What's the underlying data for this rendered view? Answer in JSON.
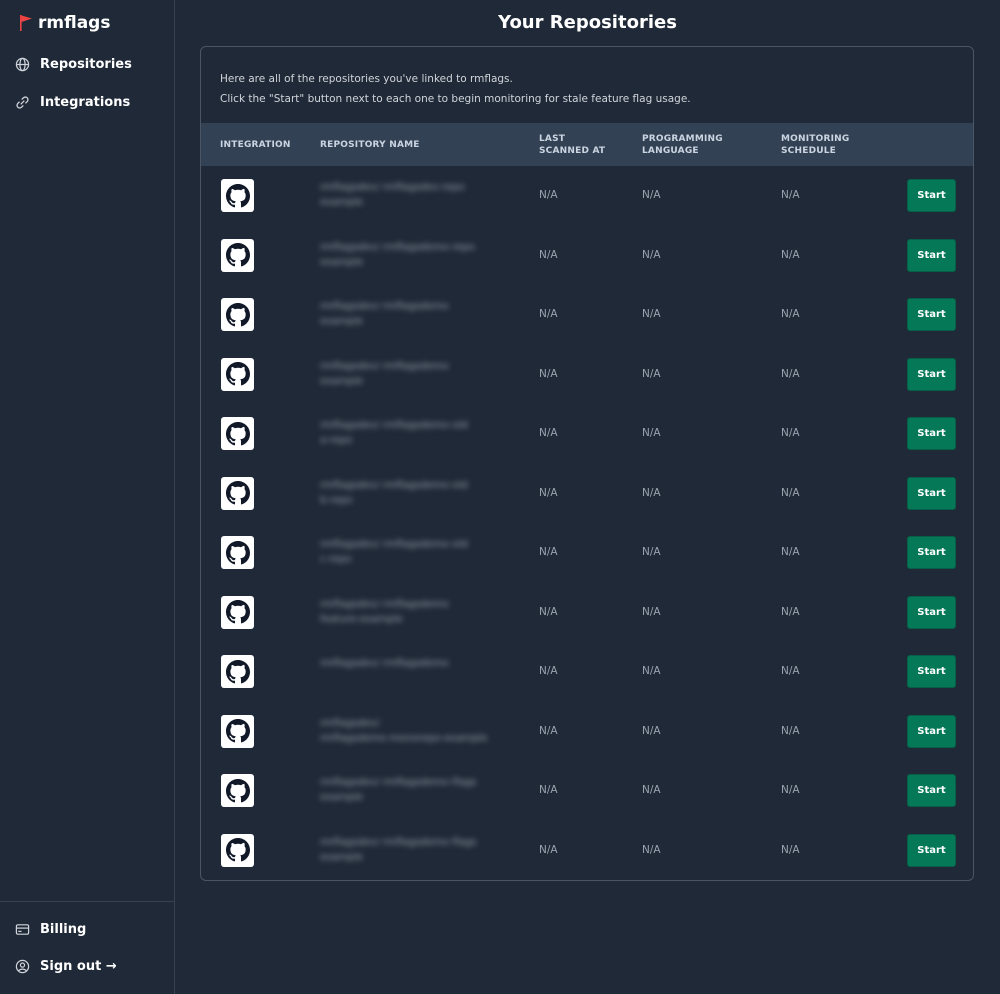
{
  "app": {
    "name": "rmflags",
    "flag_color": "#ef4444"
  },
  "nav": {
    "repositories": "Repositories",
    "integrations": "Integrations",
    "billing": "Billing",
    "signout": "Sign out →"
  },
  "page": {
    "title": "Your Repositories",
    "intro_line1": "Here are all of the repositories you've linked to rmflags.",
    "intro_line2": "Click the \"Start\" button next to each one to begin monitoring for stale feature flag usage."
  },
  "table": {
    "headers": {
      "integration": "Integration",
      "repo_name": "Repository Name",
      "last_scanned": "Last Scanned At",
      "language": "Programming Language",
      "schedule": "Monitoring Schedule"
    },
    "rows": [
      {
        "integration_icon": "github-icon",
        "name_line1": "rmflagsdev/ rmflagsdev-repo",
        "name_line2": "example",
        "last_scanned": "N/A",
        "language": "N/A",
        "schedule": "N/A",
        "action": "Start"
      },
      {
        "integration_icon": "github-icon",
        "name_line1": "rmflagsdev/ rmflagsdemo-repo",
        "name_line2": "example",
        "last_scanned": "N/A",
        "language": "N/A",
        "schedule": "N/A",
        "action": "Start"
      },
      {
        "integration_icon": "github-icon",
        "name_line1": "rmflagsdev/ rmflagsdemo",
        "name_line2": "example",
        "last_scanned": "N/A",
        "language": "N/A",
        "schedule": "N/A",
        "action": "Start"
      },
      {
        "integration_icon": "github-icon",
        "name_line1": "rmflagsdev/ rmflagsdemo",
        "name_line2": "example",
        "last_scanned": "N/A",
        "language": "N/A",
        "schedule": "N/A",
        "action": "Start"
      },
      {
        "integration_icon": "github-icon",
        "name_line1": "rmflagsdev/ rmflagsdemo-old",
        "name_line2": "a-repo",
        "last_scanned": "N/A",
        "language": "N/A",
        "schedule": "N/A",
        "action": "Start"
      },
      {
        "integration_icon": "github-icon",
        "name_line1": "rmflagsdev/ rmflagsdemo-old",
        "name_line2": "b-repo",
        "last_scanned": "N/A",
        "language": "N/A",
        "schedule": "N/A",
        "action": "Start"
      },
      {
        "integration_icon": "github-icon",
        "name_line1": "rmflagsdev/ rmflagsdemo-old",
        "name_line2": "c-repo",
        "last_scanned": "N/A",
        "language": "N/A",
        "schedule": "N/A",
        "action": "Start"
      },
      {
        "integration_icon": "github-icon",
        "name_line1": "rmflagsdev/ rmflagsdemo",
        "name_line2": "feature-example",
        "last_scanned": "N/A",
        "language": "N/A",
        "schedule": "N/A",
        "action": "Start"
      },
      {
        "integration_icon": "github-icon",
        "name_line1": "rmflagsdev/ rmflagsdemo",
        "name_line2": "",
        "last_scanned": "N/A",
        "language": "N/A",
        "schedule": "N/A",
        "action": "Start"
      },
      {
        "integration_icon": "github-icon",
        "name_line1": "rmflagsdev/",
        "name_line2": "rmflagsdemo-monorepo-example",
        "last_scanned": "N/A",
        "language": "N/A",
        "schedule": "N/A",
        "action": "Start"
      },
      {
        "integration_icon": "github-icon",
        "name_line1": "rmflagsdev/ rmflagsdemo-flags",
        "name_line2": "example",
        "last_scanned": "N/A",
        "language": "N/A",
        "schedule": "N/A",
        "action": "Start"
      },
      {
        "integration_icon": "github-icon",
        "name_line1": "rmflagsdev/ rmflagsdemo-flags",
        "name_line2": "example",
        "last_scanned": "N/A",
        "language": "N/A",
        "schedule": "N/A",
        "action": "Start"
      }
    ]
  },
  "colors": {
    "background": "#1f2937",
    "table_header": "#334155",
    "start_button": "#047857",
    "text_muted": "#9ca3af"
  }
}
